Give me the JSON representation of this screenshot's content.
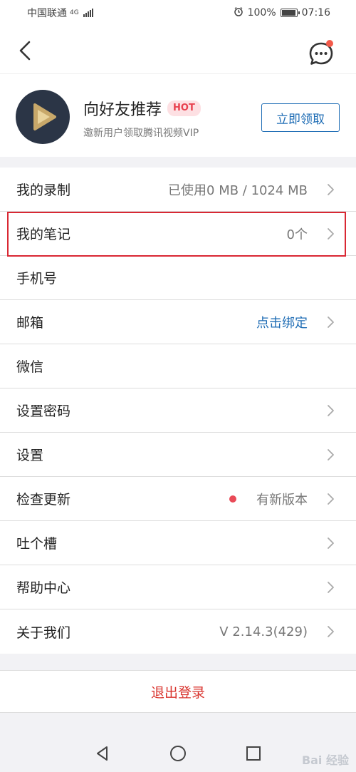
{
  "status_bar": {
    "carrier": "中国联通",
    "network": "4G",
    "battery": "100%",
    "battery_level": 1.0,
    "time": "07:16"
  },
  "nav": {
    "back_icon": "chevron-left-icon",
    "message_icon": "chat-bubble-icon",
    "has_notification": true
  },
  "promo": {
    "title": "向好友推荐",
    "badge": "HOT",
    "subtitle": "邀新用户领取腾讯视频VIP",
    "button_label": "立即领取"
  },
  "menu": {
    "items": [
      {
        "label": "我的录制",
        "value": "已使用0 MB / 1024 MB",
        "chevron": true
      },
      {
        "label": "我的笔记",
        "value": "0个",
        "chevron": true,
        "highlighted": true
      },
      {
        "label": "手机号",
        "value": "",
        "chevron": false
      },
      {
        "label": "邮箱",
        "value": "点击绑定",
        "chevron": true,
        "link": true
      },
      {
        "label": "微信",
        "value": "",
        "chevron": false
      },
      {
        "label": "设置密码",
        "value": "",
        "chevron": true
      },
      {
        "label": "设置",
        "value": "",
        "chevron": true
      },
      {
        "label": "检查更新",
        "value": "有新版本",
        "chevron": true,
        "dot": true
      },
      {
        "label": "吐个槽",
        "value": "",
        "chevron": true
      },
      {
        "label": "帮助中心",
        "value": "",
        "chevron": true
      },
      {
        "label": "关于我们",
        "value": "V 2.14.3(429)",
        "chevron": true
      }
    ]
  },
  "logout_label": "退出登录",
  "watermark": "Bai 经验",
  "colors": {
    "accent": "#1f6db5",
    "danger": "#d9352f",
    "hot_badge_bg": "#fde0e3",
    "hot_badge_text": "#e8414f",
    "highlight_border": "#d92833"
  }
}
